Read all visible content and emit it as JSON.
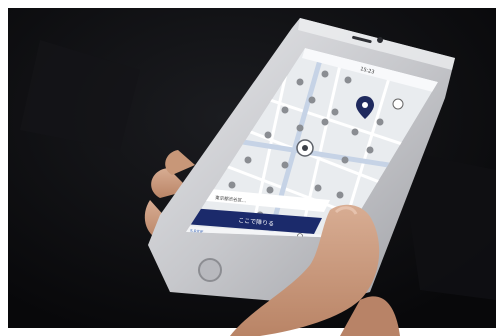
{
  "screen": {
    "status_time": "15:23",
    "address_text": "東京都渋谷区...",
    "primary_button_label": "ここで降りる",
    "brand_label": "S.RIDE"
  },
  "colors": {
    "background": "#0c0c0f",
    "phone_body": "#cfd0d4",
    "map_bg": "#e9ecef",
    "pin": "#8a8d92",
    "active_pin": "#1f2a5e",
    "button": "#1b2a6b",
    "hand": "#c99a80"
  },
  "icons": {
    "pins": "map-pin-icon",
    "current_location": "current-location-icon",
    "destination": "destination-pin-icon",
    "locate": "locate-icon",
    "search": "search-icon"
  }
}
